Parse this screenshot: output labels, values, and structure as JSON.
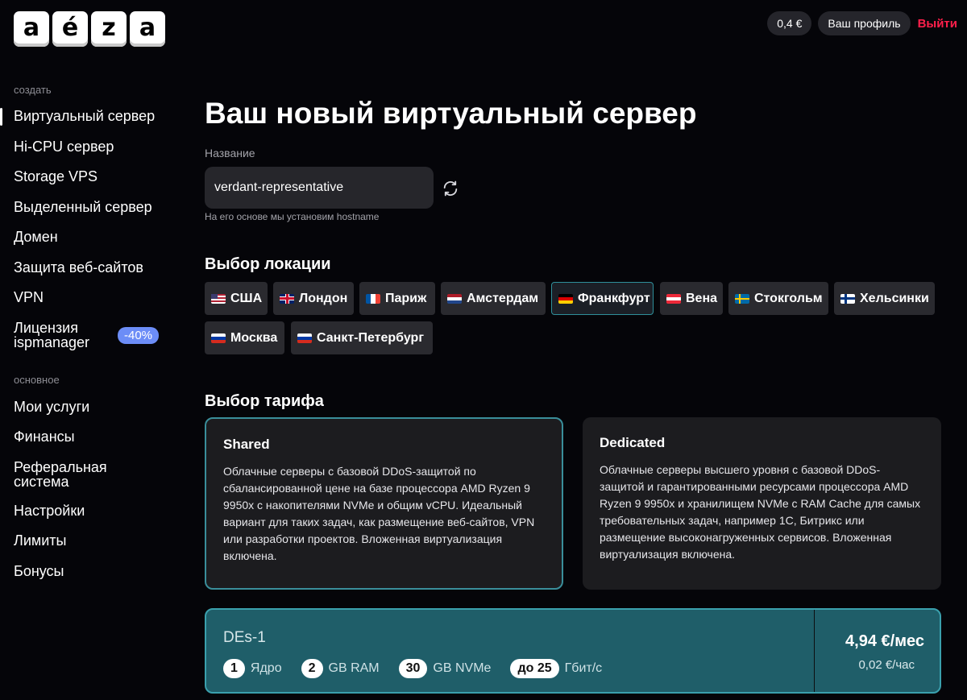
{
  "logo": {
    "letters": [
      "a",
      "é",
      "z",
      "a"
    ]
  },
  "header": {
    "balance": "0,4 €",
    "profile": "Ваш профиль",
    "logout": "Выйти"
  },
  "sidebar": {
    "create_label": "создать",
    "create_items": [
      {
        "label": "Виртуальный сервер",
        "active": true
      },
      {
        "label": "Hi-CPU сервер"
      },
      {
        "label": "Storage VPS"
      },
      {
        "label": "Выделенный сервер"
      },
      {
        "label": "Домен"
      },
      {
        "label": "Защита веб-сайтов"
      },
      {
        "label": "VPN"
      },
      {
        "label": "Лицензия ispmanager",
        "badge": "-40%"
      }
    ],
    "main_label": "основное",
    "main_items": [
      {
        "label": "Мои услуги"
      },
      {
        "label": "Финансы"
      },
      {
        "label": "Реферальная система"
      },
      {
        "label": "Настройки"
      },
      {
        "label": "Лимиты"
      },
      {
        "label": "Бонусы"
      }
    ]
  },
  "main": {
    "title": "Ваш новый виртуальный сервер",
    "name_label": "Название",
    "name_value": "verdant-representative",
    "name_hint": "На его основе мы установим hostname",
    "location_title": "Выбор локации",
    "locations": [
      {
        "label": "США",
        "flag": "us"
      },
      {
        "label": "Лондон",
        "flag": "gb"
      },
      {
        "label": "Париж",
        "flag": "fr"
      },
      {
        "label": "Амстердам",
        "flag": "nl"
      },
      {
        "label": "Франкфурт",
        "flag": "de",
        "selected": true
      },
      {
        "label": "Вена",
        "flag": "at"
      },
      {
        "label": "Стокгольм",
        "flag": "se"
      },
      {
        "label": "Хельсинки",
        "flag": "fi"
      },
      {
        "label": "Москва",
        "flag": "ru"
      },
      {
        "label": "Санкт-Петербург",
        "flag": "ru"
      }
    ],
    "tariff_title": "Выбор тарифа",
    "tariffs": [
      {
        "name": "Shared",
        "selected": true,
        "description": "Облачные серверы с базовой DDoS-защитой по сбалансированной цене на базе процессора AMD Ryzen 9 9950x с накопителями NVMe и общим vCPU. Идеальный вариант для таких задач, как размещение веб-сайтов, VPN или разработки проектов. Вложенная виртуализация включена."
      },
      {
        "name": "Dedicated",
        "description": "Облачные серверы высшего уровня с базовой DDoS-защитой и гарантированными ресурсами процессора AMD Ryzen 9 9950x и хранилищем NVMe с RAM Cache для самых требовательных задач, например 1С, Битрикс или размещение высоконагруженных сервисов. Вложенная виртуализация включена."
      }
    ],
    "plan": {
      "name": "DEs-1",
      "specs": [
        {
          "value": "1",
          "unit": "Ядро"
        },
        {
          "value": "2",
          "unit": "GB RAM"
        },
        {
          "value": "30",
          "unit": "GB NVMe"
        },
        {
          "value": "до 25",
          "unit": "Гбит/с"
        }
      ],
      "price_month": "4,94 €/мес",
      "price_hour": "0,02 €/час"
    }
  }
}
